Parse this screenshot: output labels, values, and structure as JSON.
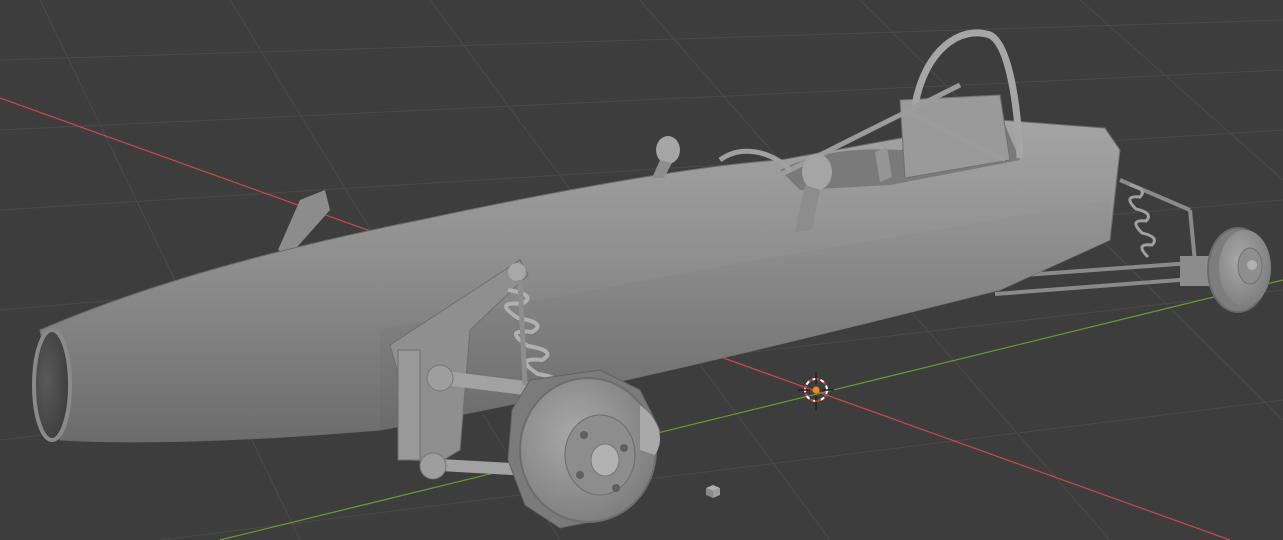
{
  "viewport": {
    "mode": "solid",
    "background_color": "#3d3d3d",
    "grid_color": "#4a4a4a",
    "x_axis_color": "#c9494f",
    "y_axis_color": "#6f9a36",
    "model_color": "#8f8f8f",
    "model_shadow_color": "#626262",
    "model_highlight_color": "#b0b0b0"
  },
  "scene": {
    "objects": [
      {
        "icon": "race-car-mesh",
        "label": ""
      },
      {
        "icon": "3d-cursor",
        "label": ""
      },
      {
        "icon": "small-cube",
        "label": ""
      }
    ]
  }
}
